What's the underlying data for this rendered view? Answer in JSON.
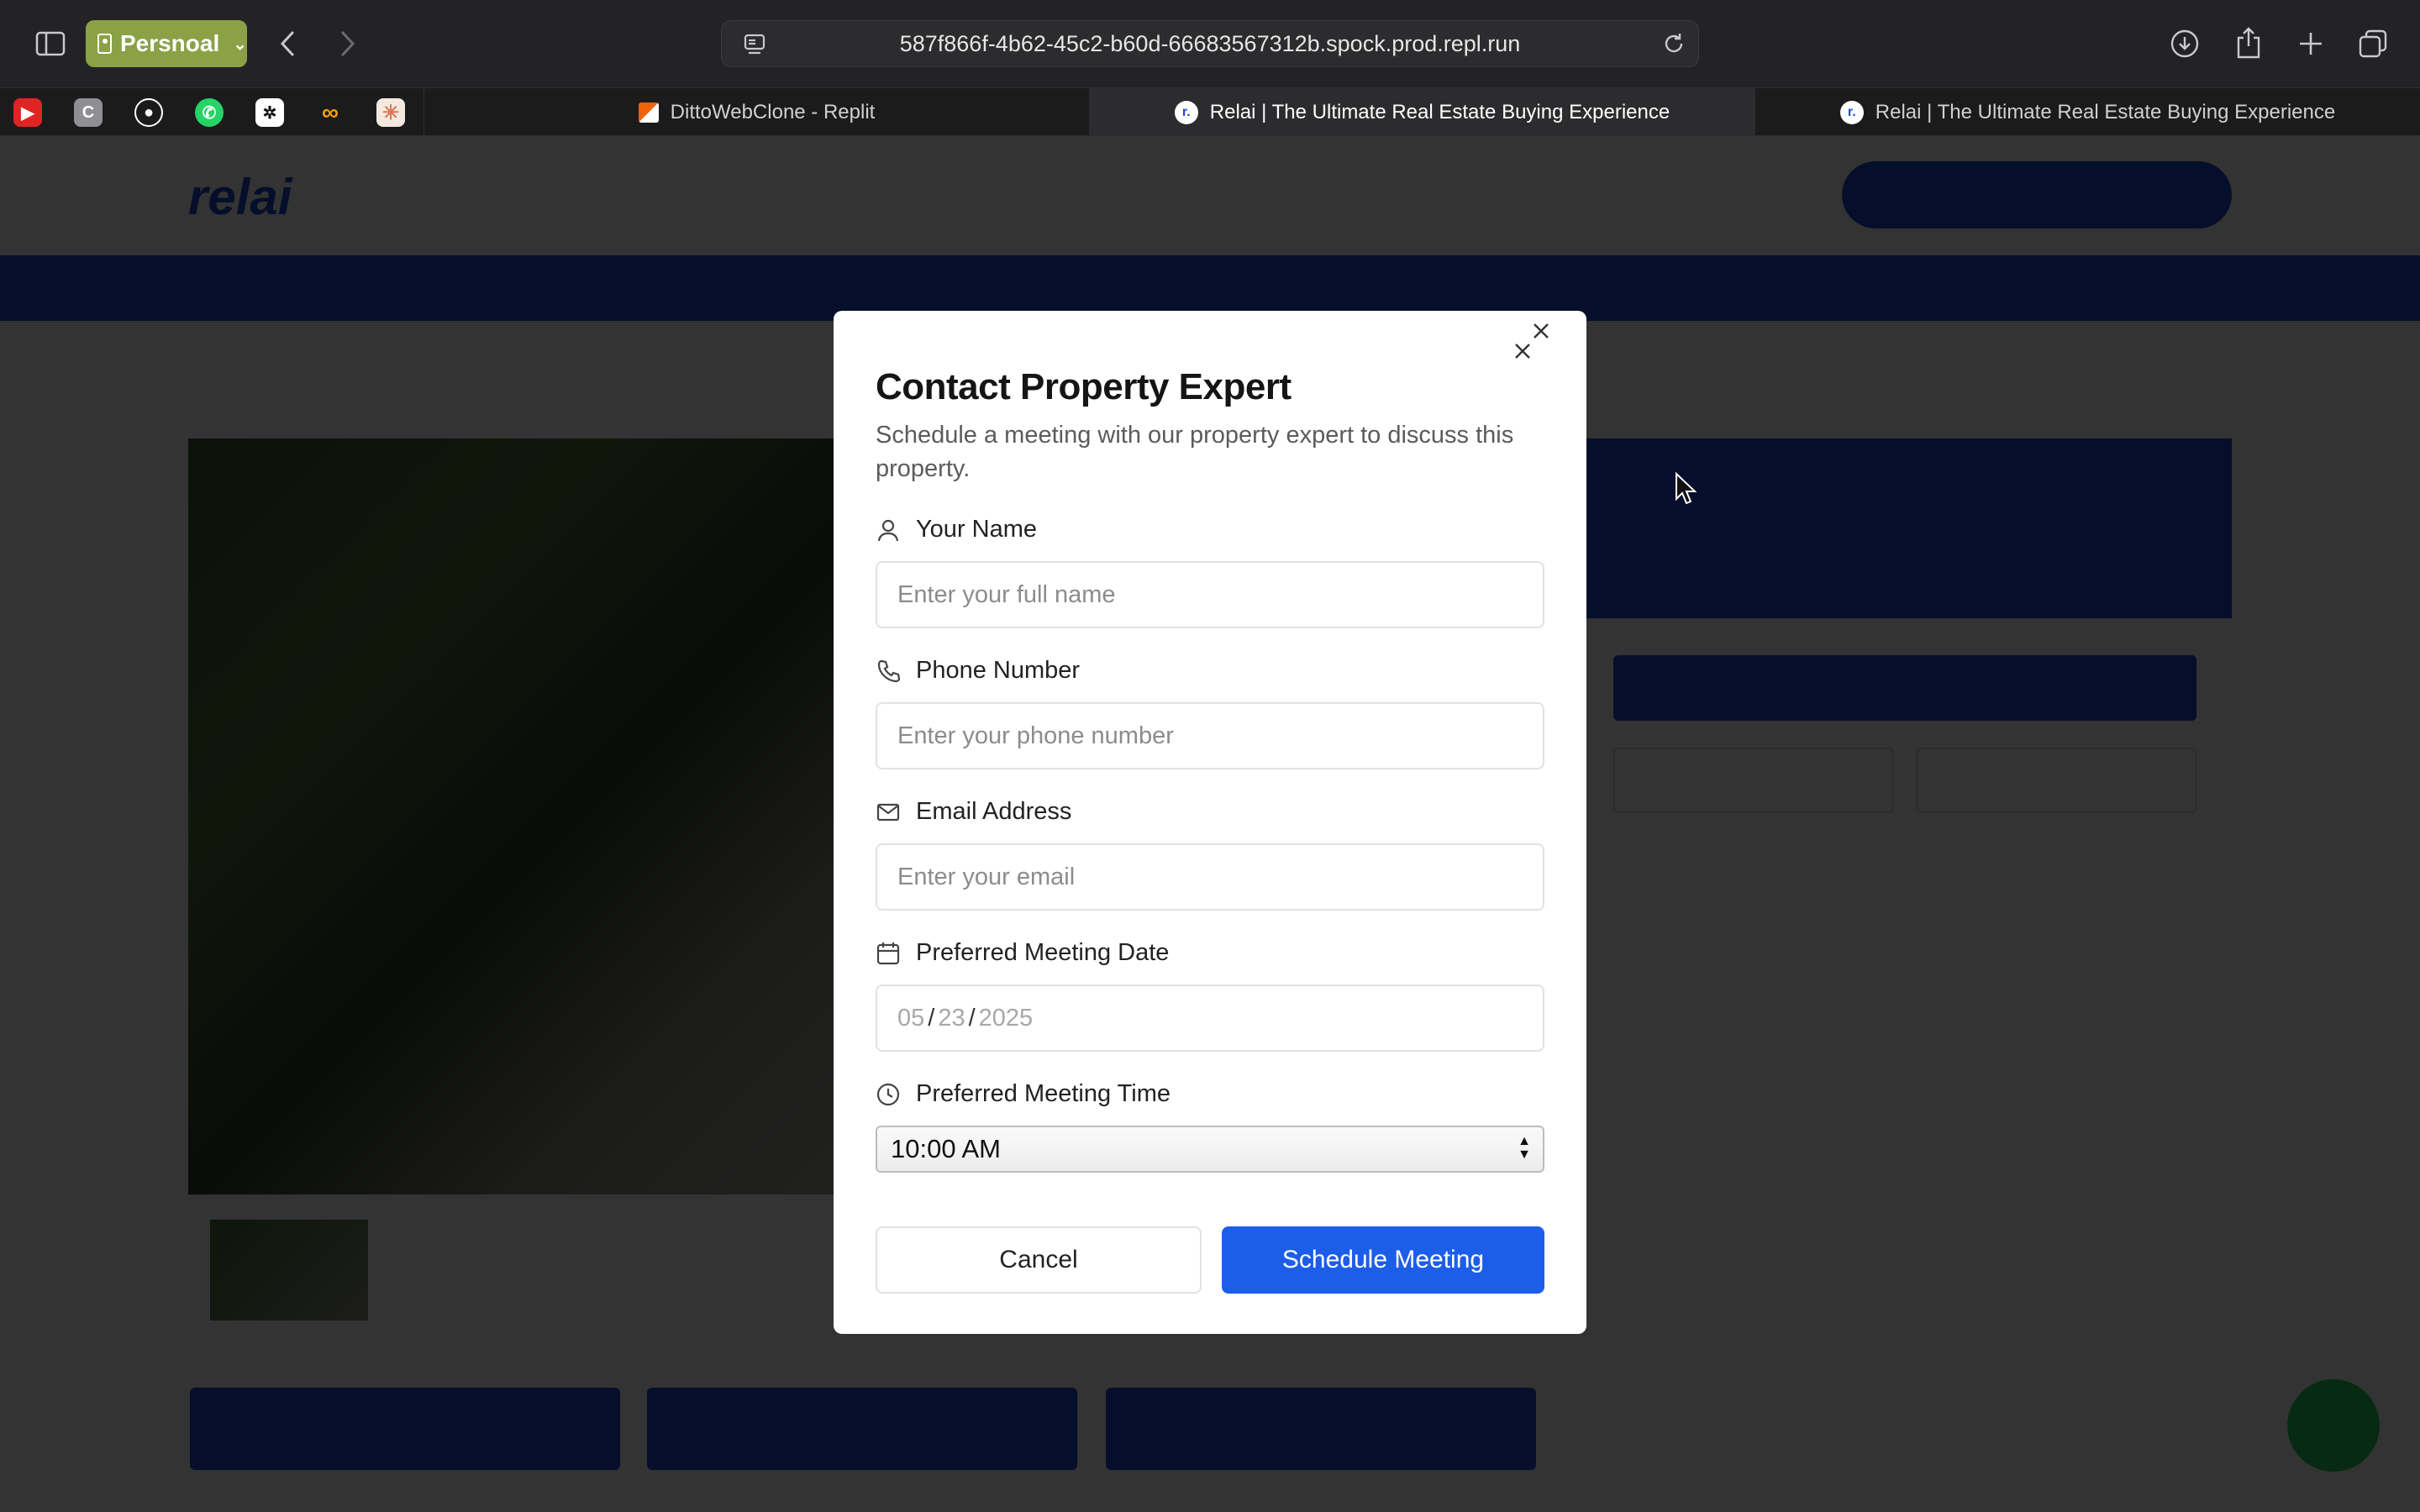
{
  "browser": {
    "profile_label": "Persnoal",
    "url": "587f866f-4b62-45c2-b60d-66683567312b.spock.prod.repl.run",
    "tabs": [
      {
        "label": "DittoWebClone - Replit",
        "active": false
      },
      {
        "label": "Relai | The Ultimate Real Estate Buying Experience",
        "active": true
      },
      {
        "label": "Relai | The Ultimate Real Estate Buying Experience",
        "active": false
      }
    ],
    "pinned_favicons": [
      "youtube-icon",
      "c-icon",
      "github-icon",
      "whatsapp-icon",
      "openai-icon",
      "infinity-icon",
      "claude-icon"
    ],
    "colors": {
      "profile": "#8aa146",
      "chrome": "#232325"
    }
  },
  "modal": {
    "title": "Contact Property Expert",
    "subtitle": "Schedule a meeting with our property expert to discuss this property.",
    "fields": {
      "name": {
        "label": "Your Name",
        "placeholder": "Enter your full name"
      },
      "phone": {
        "label": "Phone Number",
        "placeholder": "Enter your phone number"
      },
      "email": {
        "label": "Email Address",
        "placeholder": "Enter your email"
      },
      "date": {
        "label": "Preferred Meeting Date",
        "month": "05",
        "day": "23",
        "year": "2025"
      },
      "time": {
        "label": "Preferred Meeting Time",
        "value": "10:00 AM"
      }
    },
    "cancel_label": "Cancel",
    "submit_label": "Schedule Meeting",
    "colors": {
      "primary": "#1d5ee8"
    }
  },
  "background_page": {
    "brand_color": "#1d4ed8"
  }
}
